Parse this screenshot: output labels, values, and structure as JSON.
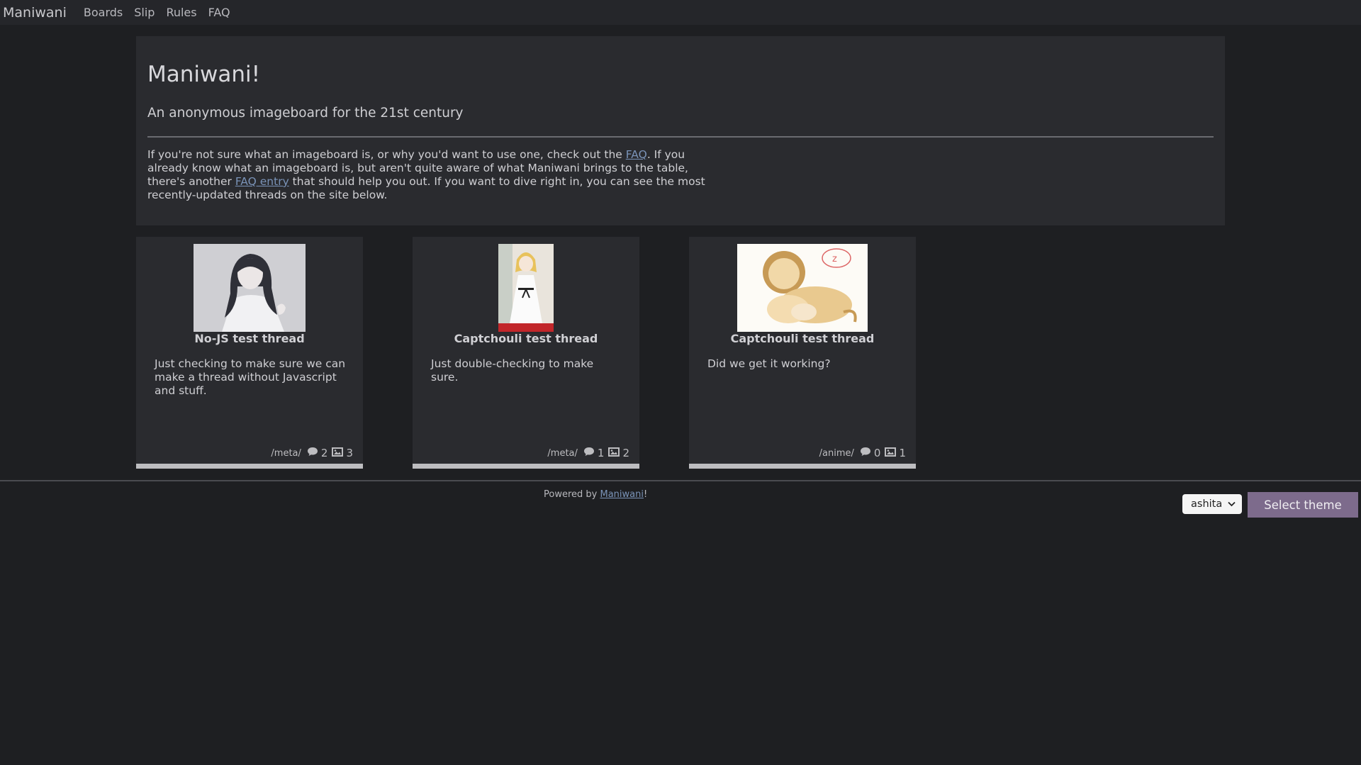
{
  "navbar": {
    "brand": "Maniwani",
    "links": [
      "Boards",
      "Slip",
      "Rules",
      "FAQ"
    ]
  },
  "hero": {
    "title": "Maniwani!",
    "subtitle": "An anonymous imageboard for the 21st century",
    "intro": {
      "p1": "If you're not sure what an imageboard is, or why you'd want to use one, check out the ",
      "link1": "FAQ",
      "p2": ". If you already know what an imageboard is, but aren't quite aware of what Maniwani brings to the table, there's another ",
      "link2": "FAQ entry",
      "p3": " that should help you out. If you want to dive right in, you can see the most recently-updated threads on the site below."
    }
  },
  "threads": [
    {
      "title": "No-JS test thread",
      "body": "Just checking to make sure we can make a thread without Javascript and stuff.",
      "board": "/meta/",
      "replies": "2",
      "images": "3"
    },
    {
      "title": "Captchouli test thread",
      "body": "Just double-checking to make sure.",
      "board": "/meta/",
      "replies": "1",
      "images": "2"
    },
    {
      "title": "Captchouli test thread",
      "body": "Did we get it working?",
      "board": "/anime/",
      "replies": "0",
      "images": "1"
    }
  ],
  "footer": {
    "powered_prefix": "Powered by ",
    "powered_link": "Maniwani",
    "powered_suffix": "!"
  },
  "theme": {
    "selected": "ashita",
    "button": "Select theme"
  },
  "colors": {
    "background": "#1e1f22",
    "panel": "#2a2b2f",
    "accent_button": "#7d6b8c",
    "link": "#7a93b8"
  }
}
